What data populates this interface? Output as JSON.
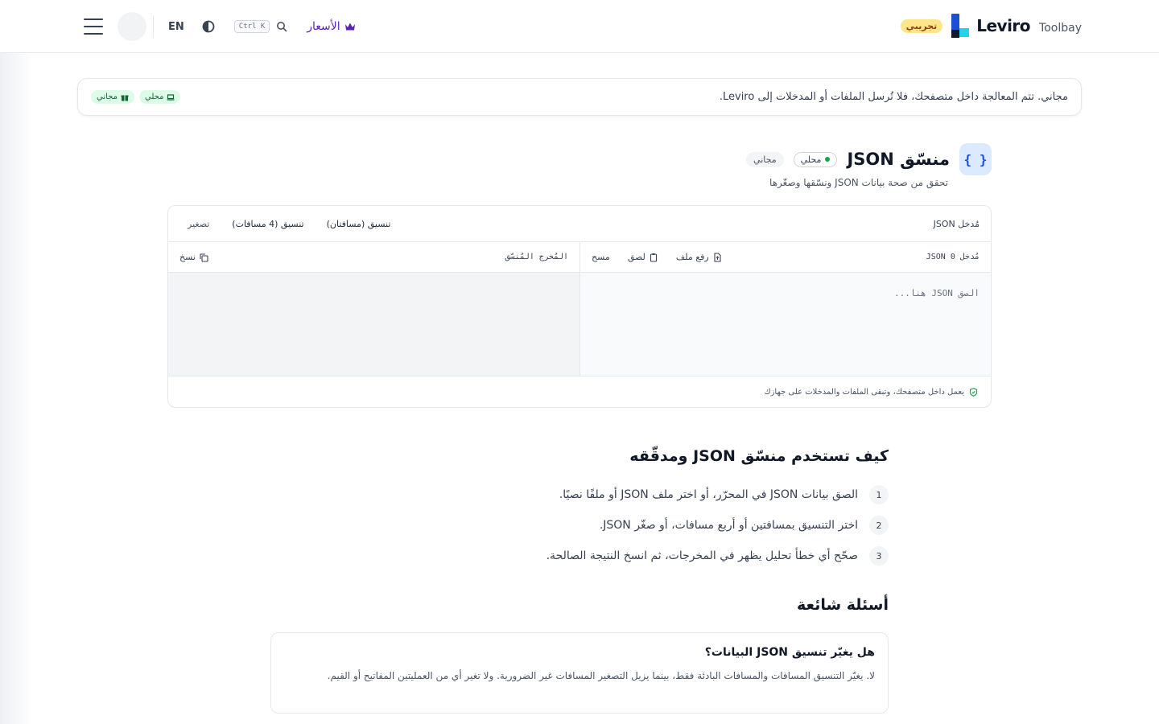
{
  "header": {
    "brand_badge": "تجريبي",
    "brand_name": "Leviro",
    "brand_sub": "Toolbay",
    "pricing_label": "الأسعار",
    "search_shortcut": "Ctrl K",
    "lang_label": "EN"
  },
  "notice": {
    "text": "مجاني. تتم المعالجة داخل متصفحك، فلا تُرسل الملفات أو المدخلات إلى Leviro.",
    "pill_local": "محلي",
    "pill_free": "مجاني"
  },
  "tool": {
    "icon": "{ }",
    "title": "منسّق JSON",
    "badge_local": "محلي",
    "badge_free": "مجاني",
    "subtitle": "تحقق من صحة بيانات JSON ونسّقها وصغّرها"
  },
  "editor": {
    "title": "مُدخل JSON",
    "actions": [
      "تنسيق (مسافتان)",
      "تنسيق (4 مسافات)",
      "تصغير"
    ],
    "input_label": "مُدخل JSON",
    "input_count": "0",
    "upload_label": "رفع ملف",
    "paste_label": "لصق",
    "clear_label": "مسح",
    "input_placeholder": "الصق JSON هنا...",
    "output_label": "المُخرج المُنسّق",
    "copy_label": "نسخ",
    "footer_note": "يعمل داخل متصفحك، وتبقى الملفات والمدخلات على جهازك"
  },
  "howto": {
    "title": "كيف تستخدم منسّق JSON ومدقّقه",
    "steps": [
      {
        "num": "1",
        "text": "الصق بيانات JSON في المحرّر، أو اختر ملف JSON أو ملفًا نصيًا."
      },
      {
        "num": "2",
        "text": "اختر التنسيق بمسافتين أو أربع مسافات، أو صغّر JSON."
      },
      {
        "num": "3",
        "text": "صحّح أي خطأ تحليل يظهر في المخرجات، ثم انسخ النتيجة الصالحة."
      }
    ]
  },
  "faq": {
    "title": "أسئلة شائعة",
    "items": [
      {
        "q": "هل يغيّر تنسيق JSON البيانات؟",
        "a": "لا. يغيّر التنسيق المسافات والمسافات البادئة فقط، بينما يزيل التصغير المسافات غير الضرورية. ولا تغير أي من العمليتين المفاتيح أو القيم."
      }
    ]
  },
  "colors": {
    "accent": "#1d4ed8",
    "pricing": "#5b21b6",
    "success": "#16a34a",
    "badge": "#fde68a"
  }
}
